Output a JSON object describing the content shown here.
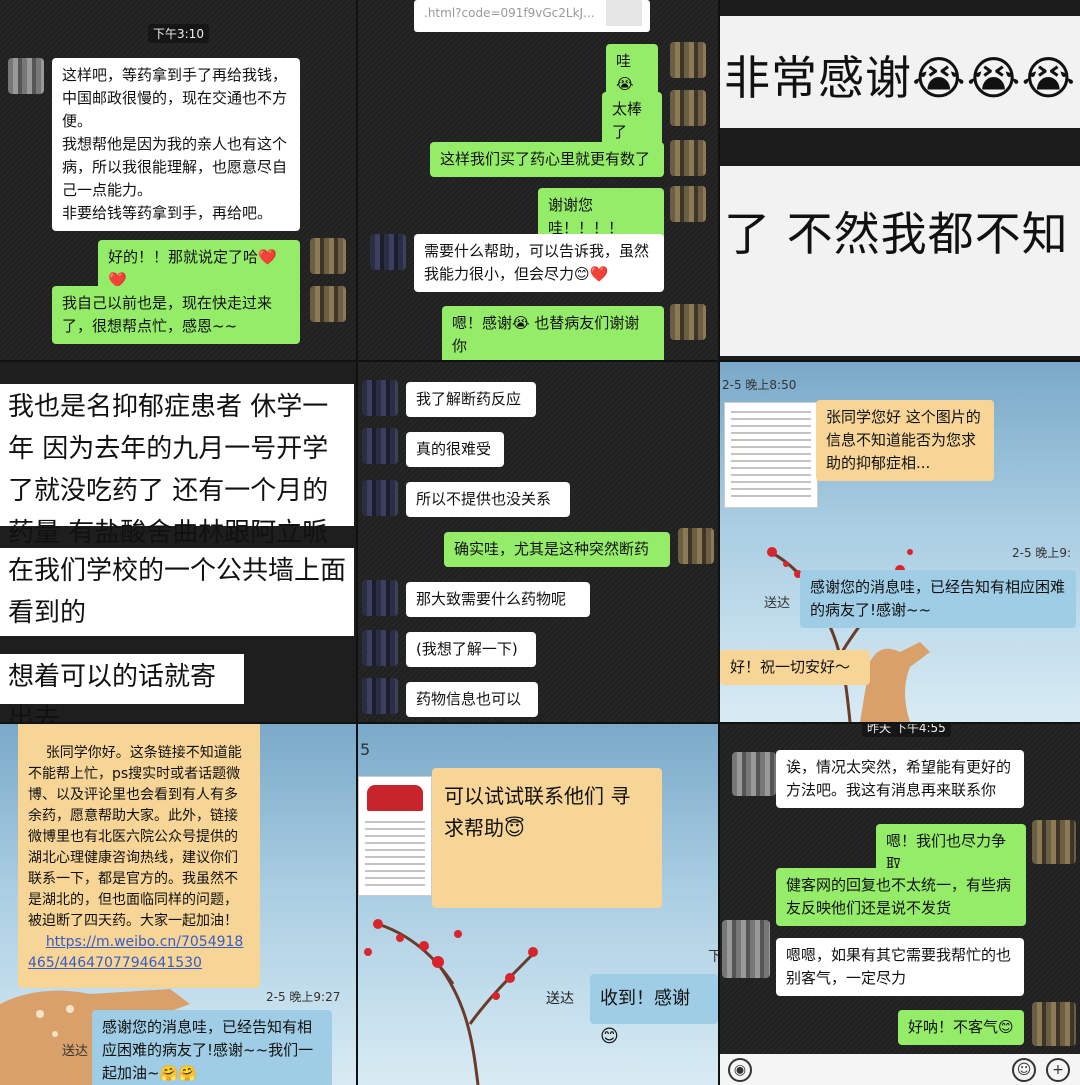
{
  "p1": {
    "timestamp": "下午3:10",
    "msg1": "这样吧，等药拿到手了再给我钱，中国邮政很慢的，现在交通也不方便。\n我想帮他是因为我的亲人也有这个病，所以我很能理解，也愿意尽自己一点能力。\n非要给钱等药拿到手，再给吧。",
    "msg2": "好的！！那就说定了哈❤️❤️",
    "msg3": "我自己以前也是，现在快走过来了，很想帮点忙，感恩~~"
  },
  "p2": {
    "link_text": ".html?code=091f9vGc2LkJ...",
    "msg1": "哇😭",
    "msg2": "太棒了",
    "msg3": "这样我们买了药心里就更有数了",
    "msg4": "谢谢您哇！！！！",
    "msg5": "需要什么帮助，可以告诉我，虽然我能力很小，但会尽力😊❤️",
    "msg6": "嗯！感谢😭 也替病友们谢谢你"
  },
  "p3": {
    "line1": "非常感谢😭😭😭",
    "line2": "了 不然我都不知"
  },
  "p4": {
    "msg1": "我也是名抑郁症患者 休学一年 因为去年的九月一号开学了就没吃药了 还有一个月的药量 有盐酸舍曲林跟阿立哌唑口崩片",
    "msg2": "在我们学校的一个公共墙上面看到的",
    "msg3": "想着可以的话就寄出去"
  },
  "p5": {
    "msg1": "我了解断药反应",
    "msg2": "真的很难受",
    "msg3": "所以不提供也没关系",
    "msg4": "确实哇，尤其是这种突然断药",
    "msg5": "那大致需要什么药物呢",
    "msg6": "(我想了解一下)",
    "msg7": "药物信息也可以"
  },
  "p6": {
    "timestamp1": "2-5 晚上8:50",
    "msg1": "张同学您好 这个图片的信息不知道能否为您求助的抑郁症相...",
    "timestamp2": "2-5 晚上9:",
    "msg2": "感谢您的消息哇，已经告知有相应困难的病友了!感谢~~",
    "sent": "送达",
    "msg3": "好！祝一切安好～"
  },
  "p7": {
    "msg1_top": "张同学你好。这条链接不知道能不能帮上忙，ps搜实时或者话题微博、以及评论里也会看到有人有多余药，愿意帮助大家。此外，链接微博里也有北医六院公众号提供的湖北心理健康咨询热线，建议你们联系一下，都是官方的。我虽然不是湖北的，但也面临同样的问题，被迫断了四天药。大家一起加油！",
    "link": "https://m.weibo.cn/7054918465/4464707794641530",
    "timestamp": "2-5 晚上9:27",
    "sent": "送达",
    "msg2": "感谢您的消息哇，已经告知有相应困难的病友了!感谢~~我们一起加油~🤗🤗"
  },
  "p8": {
    "corner": "5",
    "msg1": "可以试试联系他们 寻求帮助😇",
    "ts_corner": "下",
    "sent": "送达",
    "msg2": "收到！感谢😊"
  },
  "p9": {
    "timestamp": "昨天 下午4:55",
    "msg1": "诶，情况太突然，希望能有更好的方法吧。我这有消息再来联系你",
    "msg2": "嗯！我们也尽力争取",
    "msg3": "健客网的回复也不太统一，有些病友反映他们还是说不发货",
    "msg4": "嗯嗯，如果有其它需要我帮忙的也别客气，一定尽力",
    "msg5": "好呐！不客气😊"
  },
  "colors": {
    "wechat_green": "#95ec69",
    "in_bubble": "#ffffff",
    "sky_in": "#f6d596",
    "sky_out": "#9fcde6"
  }
}
